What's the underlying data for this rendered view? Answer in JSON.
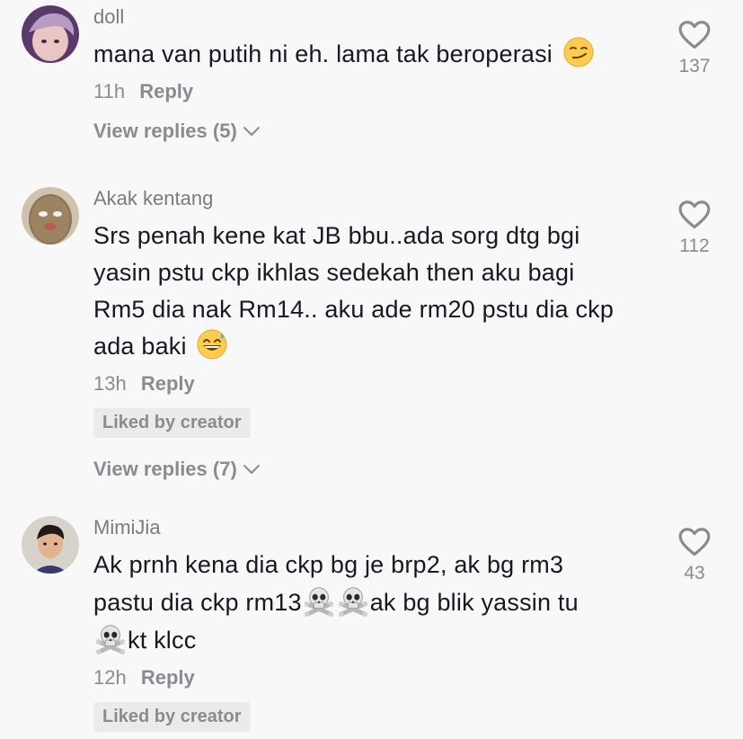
{
  "comments": [
    {
      "username": "doll",
      "text": "mana van putih ni eh. lama tak beroperasi",
      "emoji": "smirk-face-emoji",
      "time": "11h",
      "reply_label": "Reply",
      "view_replies": "View replies (5)",
      "likes": "137"
    },
    {
      "username": "Akak kentang",
      "text_lines": [
        "Srs penah kene kat JB bbu..ada sorg dtg bgi",
        "yasin pstu ckp ikhlas sedekah then aku bagi",
        "Rm5 dia nak Rm14.. aku ade rm20 pstu dia ckp",
        "ada baki"
      ],
      "emoji": "grinning-sweat-emoji",
      "time": "13h",
      "reply_label": "Reply",
      "liked_by": "Liked by creator",
      "view_replies": "View replies (7)",
      "likes": "112"
    },
    {
      "username": "MimiJia",
      "text_line1": "Ak prnh kena dia ckp bg je brp2, ak bg rm3",
      "text_line2a": "pastu dia ckp rm13",
      "text_line2b": "ak bg blik yassin tu",
      "text_line3": "kt klcc",
      "emoji": "skull-crossbones-emoji",
      "time": "12h",
      "reply_label": "Reply",
      "liked_by": "Liked by creator",
      "likes": "43"
    }
  ],
  "colors": {
    "background": "#f8f8f8",
    "text": "#161823",
    "muted": "#8a8b91",
    "badge": "#ebebeb"
  }
}
